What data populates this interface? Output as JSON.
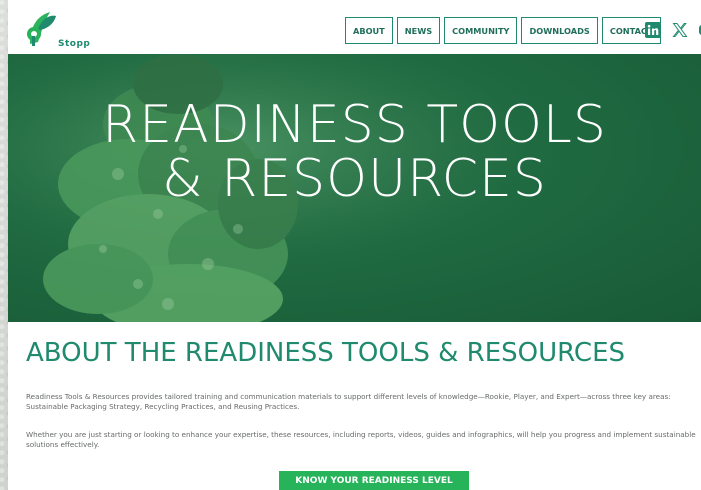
{
  "header": {
    "logo_text": "Stopp",
    "nav": [
      "ABOUT",
      "NEWS",
      "COMMUNITY",
      "DOWNLOADS",
      "CONTACT"
    ],
    "social_icons": [
      "linkedin-icon",
      "x-icon",
      "youtube-icon"
    ]
  },
  "hero": {
    "title_line1": "READINESS TOOLS",
    "title_line2": "& RESOURCES"
  },
  "about": {
    "title": "ABOUT THE READINESS TOOLS & RESOURCES",
    "paragraph1": "Readiness Tools & Resources provides tailored training and communication materials to support different levels of knowledge—Rookie, Player, and Expert—across three key areas: Sustainable Packaging Strategy, Recycling Practices, and Reusing Practices.",
    "paragraph2": "Whether you are just starting or looking to enhance your expertise, these resources, including reports, videos, guides and infographics, will help you progress and implement sustainable solutions effectively.",
    "cta_label": "KNOW YOUR READINESS LEVEL"
  },
  "colors": {
    "brand_green": "#1f8a6e",
    "hero_green": "#1f6a41",
    "cta_green": "#27b35a"
  }
}
